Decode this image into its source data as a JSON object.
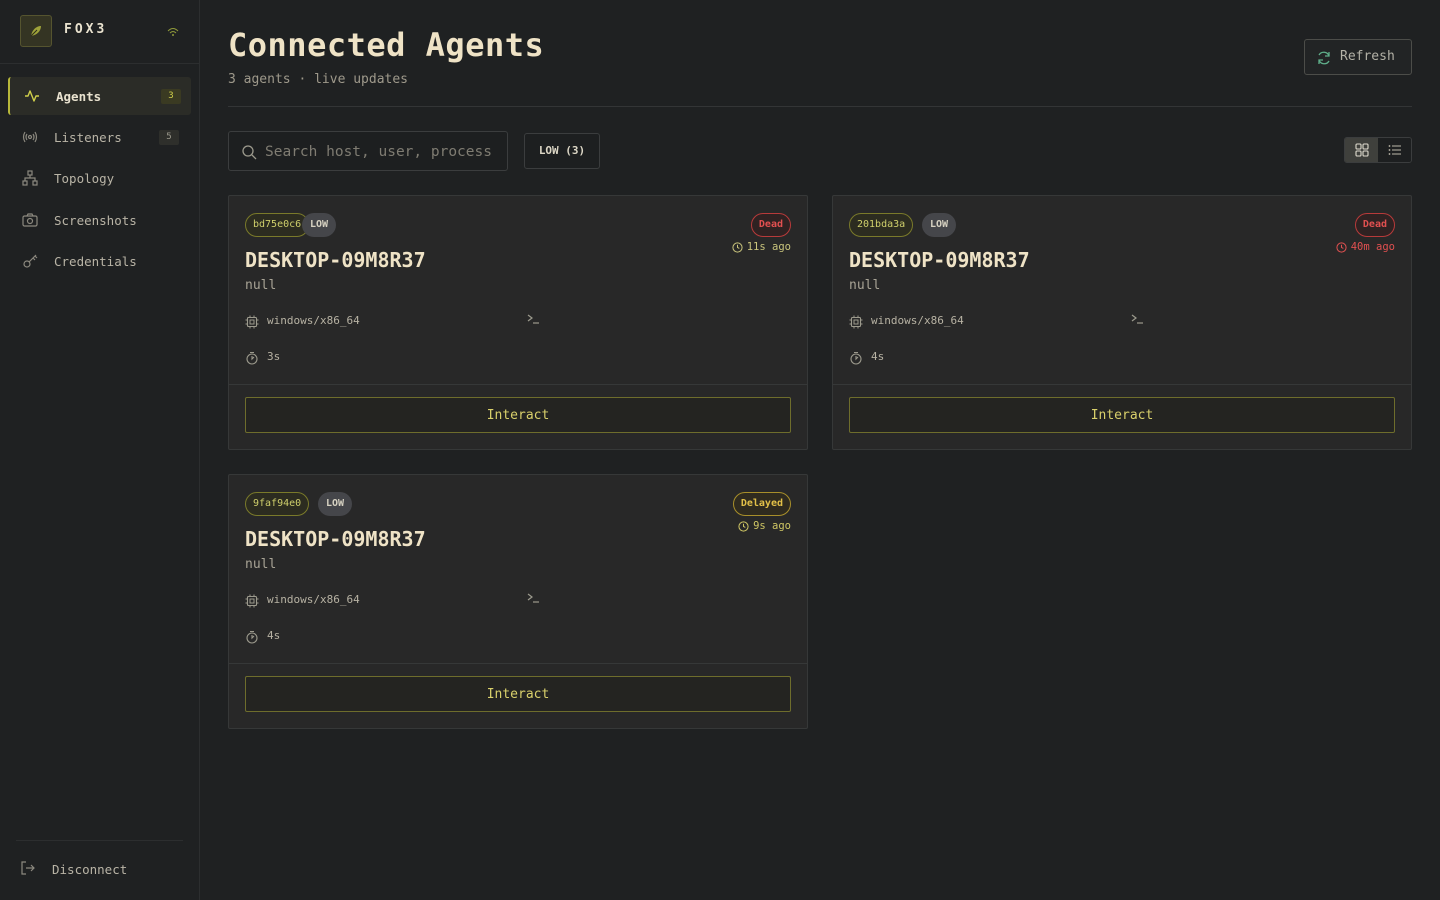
{
  "app": {
    "name": "FOX3",
    "accent": "#b8b83a"
  },
  "sidebar": {
    "items": [
      {
        "label": "Agents",
        "badge": "3",
        "icon": "activity-icon",
        "active": true
      },
      {
        "label": "Listeners",
        "badge": "5",
        "icon": "broadcast-icon",
        "active": false
      },
      {
        "label": "Topology",
        "badge": "",
        "icon": "network-icon",
        "active": false
      },
      {
        "label": "Screenshots",
        "badge": "",
        "icon": "camera-icon",
        "active": false
      },
      {
        "label": "Credentials",
        "badge": "",
        "icon": "key-icon",
        "active": false
      }
    ],
    "disconnect_label": "Disconnect"
  },
  "header": {
    "title": "Connected Agents",
    "subtitle": "3 agents · live updates",
    "refresh_label": "Refresh"
  },
  "toolbar": {
    "search_placeholder": "Search host, user, process",
    "search_value": "",
    "filter_chip": "LOW (3)"
  },
  "agents": [
    {
      "id": "bd75e0c6",
      "privilege": "LOW",
      "status": "Dead",
      "last_seen": "11s ago",
      "hostname": "DESKTOP-09M8R37",
      "user": "null",
      "arch": "windows/x86_64",
      "sleep": "3s",
      "interact_label": "Interact"
    },
    {
      "id": "201bda3a",
      "privilege": "LOW",
      "status": "Dead",
      "last_seen": "40m ago",
      "hostname": "DESKTOP-09M8R37",
      "user": "null",
      "arch": "windows/x86_64",
      "sleep": "4s",
      "interact_label": "Interact"
    },
    {
      "id": "9faf94e0",
      "privilege": "LOW",
      "status": "Delayed",
      "last_seen": "9s ago",
      "hostname": "DESKTOP-09M8R37",
      "user": "null",
      "arch": "windows/x86_64",
      "sleep": "4s",
      "interact_label": "Interact"
    }
  ],
  "colors": {
    "dead": "#e15050",
    "delayed": "#e2c048",
    "background": "#1f2122",
    "card": "#282828"
  }
}
